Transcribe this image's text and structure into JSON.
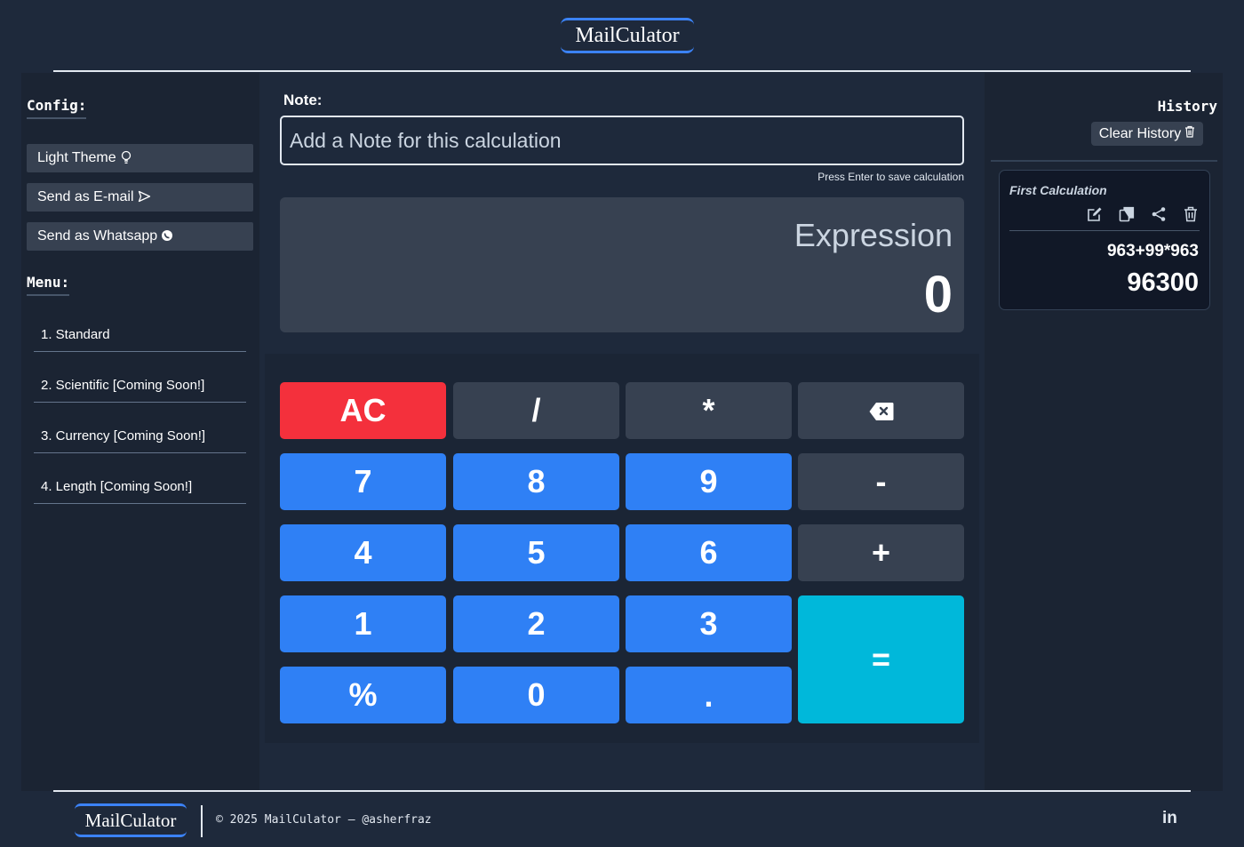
{
  "header": {
    "logo": "MailCulator"
  },
  "config": {
    "title": "Config:",
    "buttons": [
      {
        "label": "Light Theme",
        "icon": "lightbulb-icon"
      },
      {
        "label": "Send as E-mail",
        "icon": "send-icon"
      },
      {
        "label": "Send as Whatsapp",
        "icon": "whatsapp-icon"
      }
    ]
  },
  "menu": {
    "title": "Menu:",
    "items": [
      "1. Standard",
      "2. Scientific [Coming Soon!]",
      "3. Currency [Coming Soon!]",
      "4. Length [Coming Soon!]"
    ]
  },
  "note": {
    "label": "Note:",
    "placeholder": "Add a Note for this calculation",
    "hint": "Press Enter to save calculation"
  },
  "display": {
    "expression": "Expression",
    "result": "0"
  },
  "keys": {
    "ac": "AC",
    "divide": "/",
    "multiply": "*",
    "backspace_icon": "backspace-icon",
    "seven": "7",
    "eight": "8",
    "nine": "9",
    "minus": "-",
    "four": "4",
    "five": "5",
    "six": "6",
    "plus": "+",
    "one": "1",
    "two": "2",
    "three": "3",
    "equals": "=",
    "percent": "%",
    "zero": "0",
    "dot": "."
  },
  "history": {
    "title": "History",
    "clear_label": "Clear History",
    "entries": [
      {
        "note": "First Calculation",
        "expression": "963+99*963",
        "result": "96300"
      }
    ]
  },
  "footer": {
    "logo": "MailCulator",
    "copyright": "© 2025 MailCulator — @asherfraz",
    "social": "in"
  },
  "colors": {
    "background": "#1e293b",
    "accent": "#3b82f6",
    "number_key": "#2f80f5",
    "operator_key": "#374151",
    "clear_key": "#f4303c",
    "equals_key": "#00b8da"
  }
}
